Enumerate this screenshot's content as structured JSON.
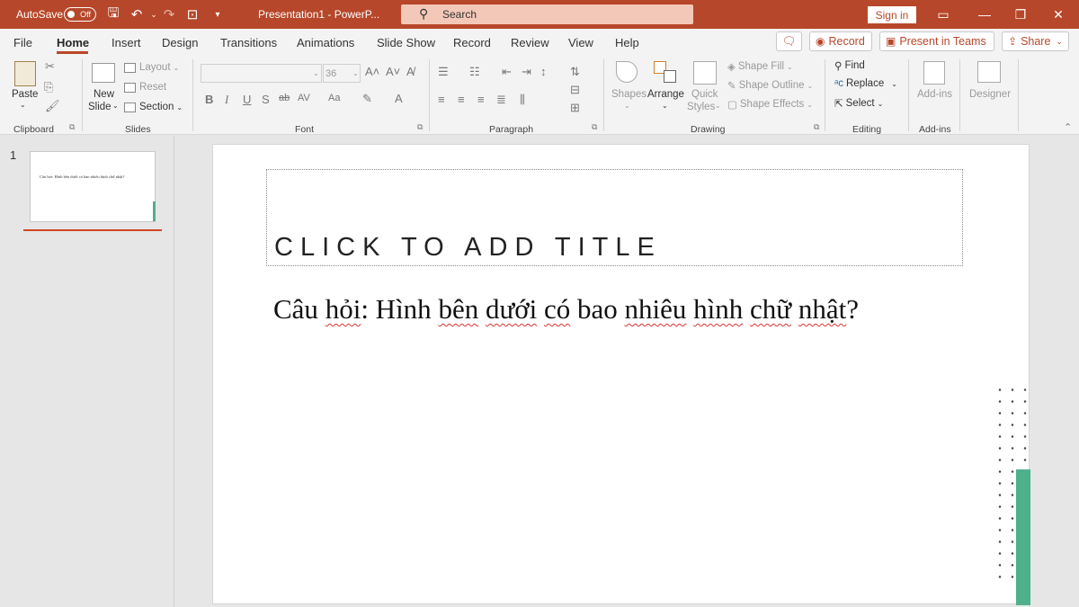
{
  "titlebar": {
    "autosave_label": "AutoSave",
    "autosave_state": "Off",
    "doc_title": "Presentation1  -  PowerP...",
    "search_placeholder": "Search",
    "sign_in": "Sign in"
  },
  "menu": {
    "tabs": [
      "File",
      "Home",
      "Insert",
      "Design",
      "Transitions",
      "Animations",
      "Slide Show",
      "Record",
      "Review",
      "View",
      "Help"
    ],
    "active_tab": "Home",
    "record_btn": "Record",
    "present_btn": "Present in Teams",
    "share_btn": "Share"
  },
  "ribbon": {
    "clipboard": {
      "label": "Clipboard",
      "paste": "Paste"
    },
    "slides": {
      "label": "Slides",
      "new_slide": "New",
      "new_slide2": "Slide",
      "layout": "Layout",
      "reset": "Reset",
      "section": "Section"
    },
    "font": {
      "label": "Font",
      "size": "36"
    },
    "paragraph": {
      "label": "Paragraph"
    },
    "drawing": {
      "label": "Drawing",
      "shapes": "Shapes",
      "arrange": "Arrange",
      "quick": "Quick",
      "styles": "Styles",
      "shape_fill": "Shape Fill",
      "shape_outline": "Shape Outline",
      "shape_effects": "Shape Effects"
    },
    "editing": {
      "label": "Editing",
      "find": "Find",
      "replace": "Replace",
      "select": "Select"
    },
    "addins": {
      "label": "Add-ins",
      "addins_btn": "Add-ins"
    },
    "designer": {
      "label": "Designer"
    }
  },
  "thumbnails": [
    {
      "number": "1",
      "text": "Câu hỏi: Hình bên dưới có bao nhiêu hình chữ nhật?"
    }
  ],
  "slide": {
    "title_placeholder": "CLICK TO ADD TITLE",
    "body_parts": [
      "Câu ",
      "hỏi",
      ": Hình ",
      "bên",
      " ",
      "dưới",
      " ",
      "có",
      " bao ",
      "nhiêu",
      " ",
      "hình",
      " ",
      "chữ",
      " ",
      "nhật",
      "?"
    ]
  },
  "colors": {
    "accent": "#b7472a",
    "green": "#4fb08c"
  }
}
